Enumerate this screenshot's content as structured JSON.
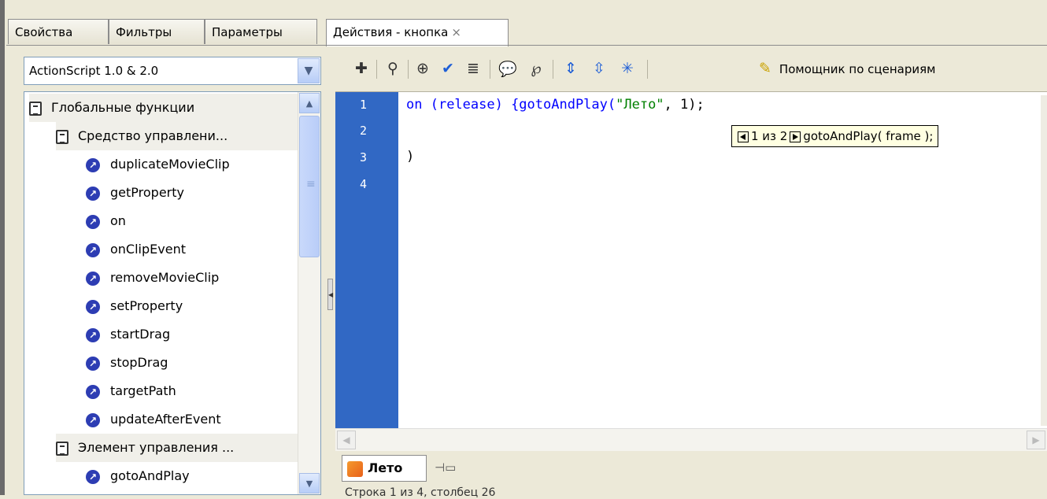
{
  "tabs": [
    {
      "label": "Свойства"
    },
    {
      "label": "Фильтры"
    },
    {
      "label": "Параметры"
    },
    {
      "label": "Действия - кнопка",
      "close": "×"
    }
  ],
  "language_select": {
    "value": "ActionScript 1.0 & 2.0"
  },
  "tree": {
    "items": [
      {
        "label": "Глобальные функции",
        "kind": "folder"
      },
      {
        "label": "Средство управлени...",
        "kind": "folder"
      },
      {
        "label": "duplicateMovieClip",
        "kind": "function"
      },
      {
        "label": "getProperty",
        "kind": "function"
      },
      {
        "label": "on",
        "kind": "function"
      },
      {
        "label": "onClipEvent",
        "kind": "function"
      },
      {
        "label": "removeMovieClip",
        "kind": "function"
      },
      {
        "label": "setProperty",
        "kind": "function"
      },
      {
        "label": "startDrag",
        "kind": "function"
      },
      {
        "label": "stopDrag",
        "kind": "function"
      },
      {
        "label": "targetPath",
        "kind": "function"
      },
      {
        "label": "updateAfterEvent",
        "kind": "function"
      },
      {
        "label": "Элемент управления ...",
        "kind": "folder"
      },
      {
        "label": "gotoAndPlay",
        "kind": "function"
      }
    ]
  },
  "toolbar": {
    "helper_label": "Помощник по сценариям",
    "icons": [
      "add-statement-icon",
      "find-icon",
      "target-path-icon",
      "check-syntax-icon",
      "auto-format-icon",
      "show-code-hint-icon",
      "debug-options-icon",
      "collapse-between-braces-icon",
      "collapse-selection-icon",
      "expand-all-icon"
    ]
  },
  "editor": {
    "line_numbers": [
      "1",
      "2",
      "3",
      "4"
    ],
    "code": {
      "line1_kw": "on",
      "line1_a": " (release) {gotoAndPlay(",
      "line1_str": "\"Лето\"",
      "line1_b": ", 1);",
      "line3": ")"
    },
    "tooltip": {
      "counter": "1 из 2",
      "signature": "gotoAndPlay( frame );"
    }
  },
  "doc_tab": {
    "label": "Лето"
  },
  "status": {
    "text": "Строка 1 из 4, столбец 26"
  }
}
